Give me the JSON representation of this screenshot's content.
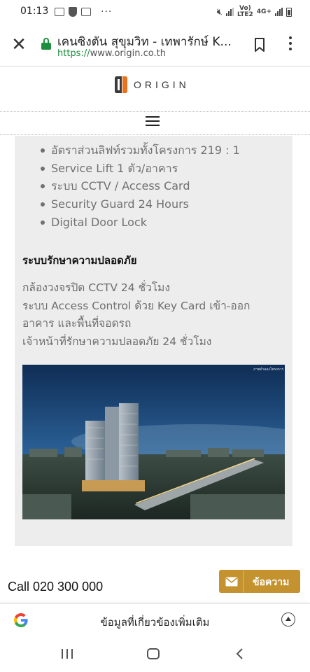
{
  "status_bar": {
    "time": "01:13",
    "more": "···",
    "network_top": "Vo)",
    "network_bottom": "LTE2",
    "network_type": "4G+"
  },
  "browser": {
    "page_title": "เคนซิงตัน สุขุมวิท - เทพารักษ์ K...",
    "url_scheme": "https://",
    "url_host": "www.origin.co.th",
    "close_icon": "close-icon",
    "bookmark_icon": "bookmark-icon",
    "menu_icon": "more-vert-icon"
  },
  "site": {
    "logo_text": "ORIGIN",
    "brand_colors": {
      "orange": "#e8731f",
      "dark": "#3a3a3a"
    }
  },
  "content": {
    "features": [
      "อัตราส่วนลิฟท์รวมทั้งโครงการ 219 :  1",
      "Service Lift 1 ตัว/อาคาร",
      "ระบบ CCTV / Access Card",
      "Security Guard 24 Hours",
      "Digital Door Lock"
    ],
    "security_heading": "ระบบรักษาความปลอดภัย",
    "security_lines": [
      "กล้องวงจรปิด CCTV 24 ชั่วโมง",
      "ระบบ Access Control ด้วย Key Card เข้า-ออก",
      "อาคาร และพื้นที่จอดรถ",
      "เจ้าหน้าที่รักษาความปลอดภัย 24 ชั่วโมง"
    ],
    "image_caption": "ภาพจำลองโครงการ"
  },
  "callbar": {
    "call_text": "Call 020 300 000",
    "message_label": "ข้อความ",
    "button_color": "#c4932f"
  },
  "google_bar": {
    "text": "ข้อมูลที่เกี่ยวข้องเพิ่มเติม"
  }
}
